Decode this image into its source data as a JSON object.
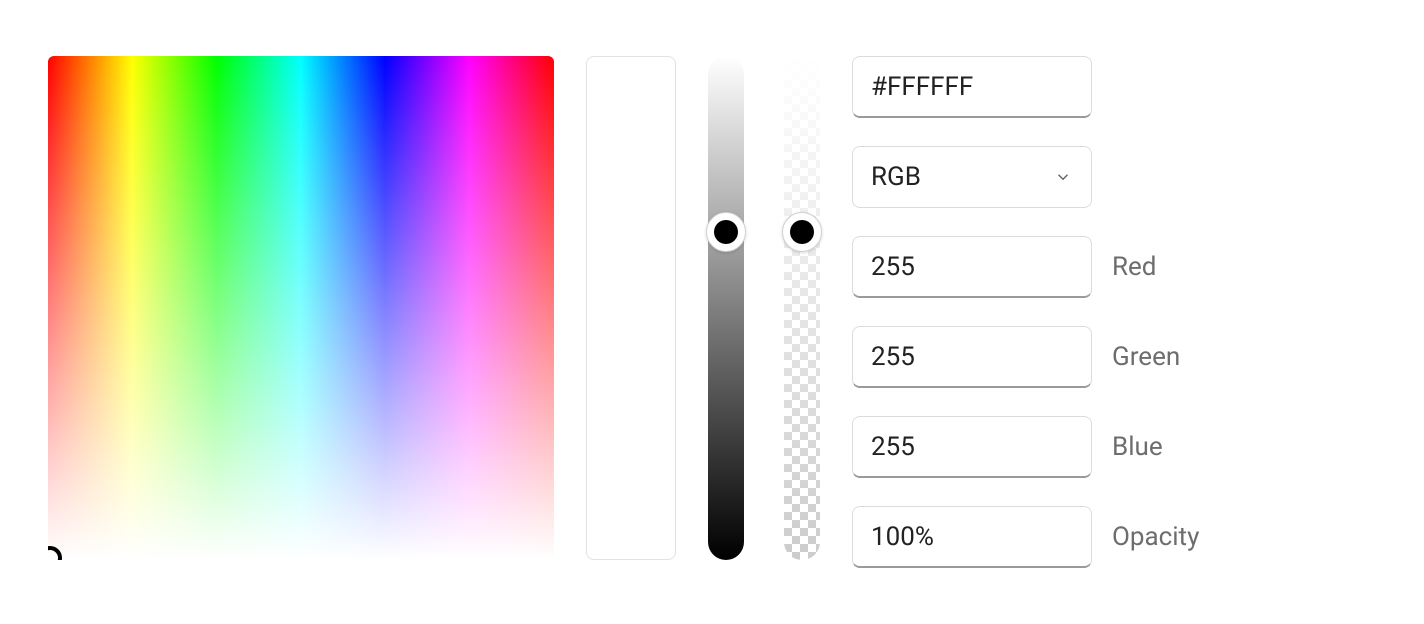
{
  "hex_value": "#FFFFFF",
  "format": {
    "selected": "RGB"
  },
  "channels": {
    "red": {
      "label": "Red",
      "value": "255"
    },
    "green": {
      "label": "Green",
      "value": "255"
    },
    "blue": {
      "label": "Blue",
      "value": "255"
    },
    "opacity": {
      "label": "Opacity",
      "value": "100%"
    }
  }
}
